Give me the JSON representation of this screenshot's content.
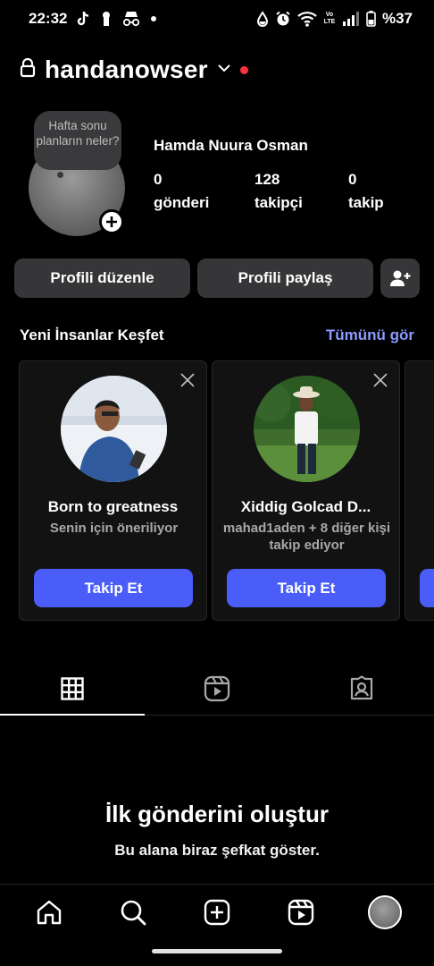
{
  "status_bar": {
    "time": "22:32",
    "battery": "%37",
    "network_label": "Vo LTE"
  },
  "header": {
    "username": "handanowser",
    "lock_icon": "lock-icon",
    "dropdown_icon": "chevron-down-icon",
    "notification_dot_color": "#ff3040"
  },
  "profile": {
    "note": "Hafta sonu planların neler?",
    "full_name": "Hamda Nuura Osman",
    "stats": [
      {
        "value": "0",
        "label": "gönderi"
      },
      {
        "value": "128",
        "label": "takipçi"
      },
      {
        "value": "0",
        "label": "takip"
      }
    ]
  },
  "buttons": {
    "edit_profile": "Profili düzenle",
    "share_profile": "Profili paylaş",
    "add_person_icon": "add-person-icon"
  },
  "discover": {
    "title": "Yeni İnsanlar Keşfet",
    "see_all": "Tümünü gör",
    "cards": [
      {
        "name": "Born to greatness",
        "subtitle": "Senin için öneriliyor",
        "follow": "Takip Et"
      },
      {
        "name": "Xiddig Golcad D...",
        "subtitle": "mahad1aden + 8 diğer kişi takip ediyor",
        "follow": "Takip Et"
      }
    ]
  },
  "tabs": [
    {
      "icon": "grid-icon",
      "active": true
    },
    {
      "icon": "reels-icon",
      "active": false
    },
    {
      "icon": "tagged-icon",
      "active": false
    }
  ],
  "empty_state": {
    "title": "İlk gönderini oluştur",
    "subtitle": "Bu alana biraz şefkat göster."
  },
  "bottom_nav": [
    "home-icon",
    "search-icon",
    "create-icon",
    "reels-icon",
    "profile-avatar"
  ],
  "colors": {
    "accent_link": "#8c9bff",
    "follow_button": "#4a5df9",
    "button_bg": "#363638"
  }
}
